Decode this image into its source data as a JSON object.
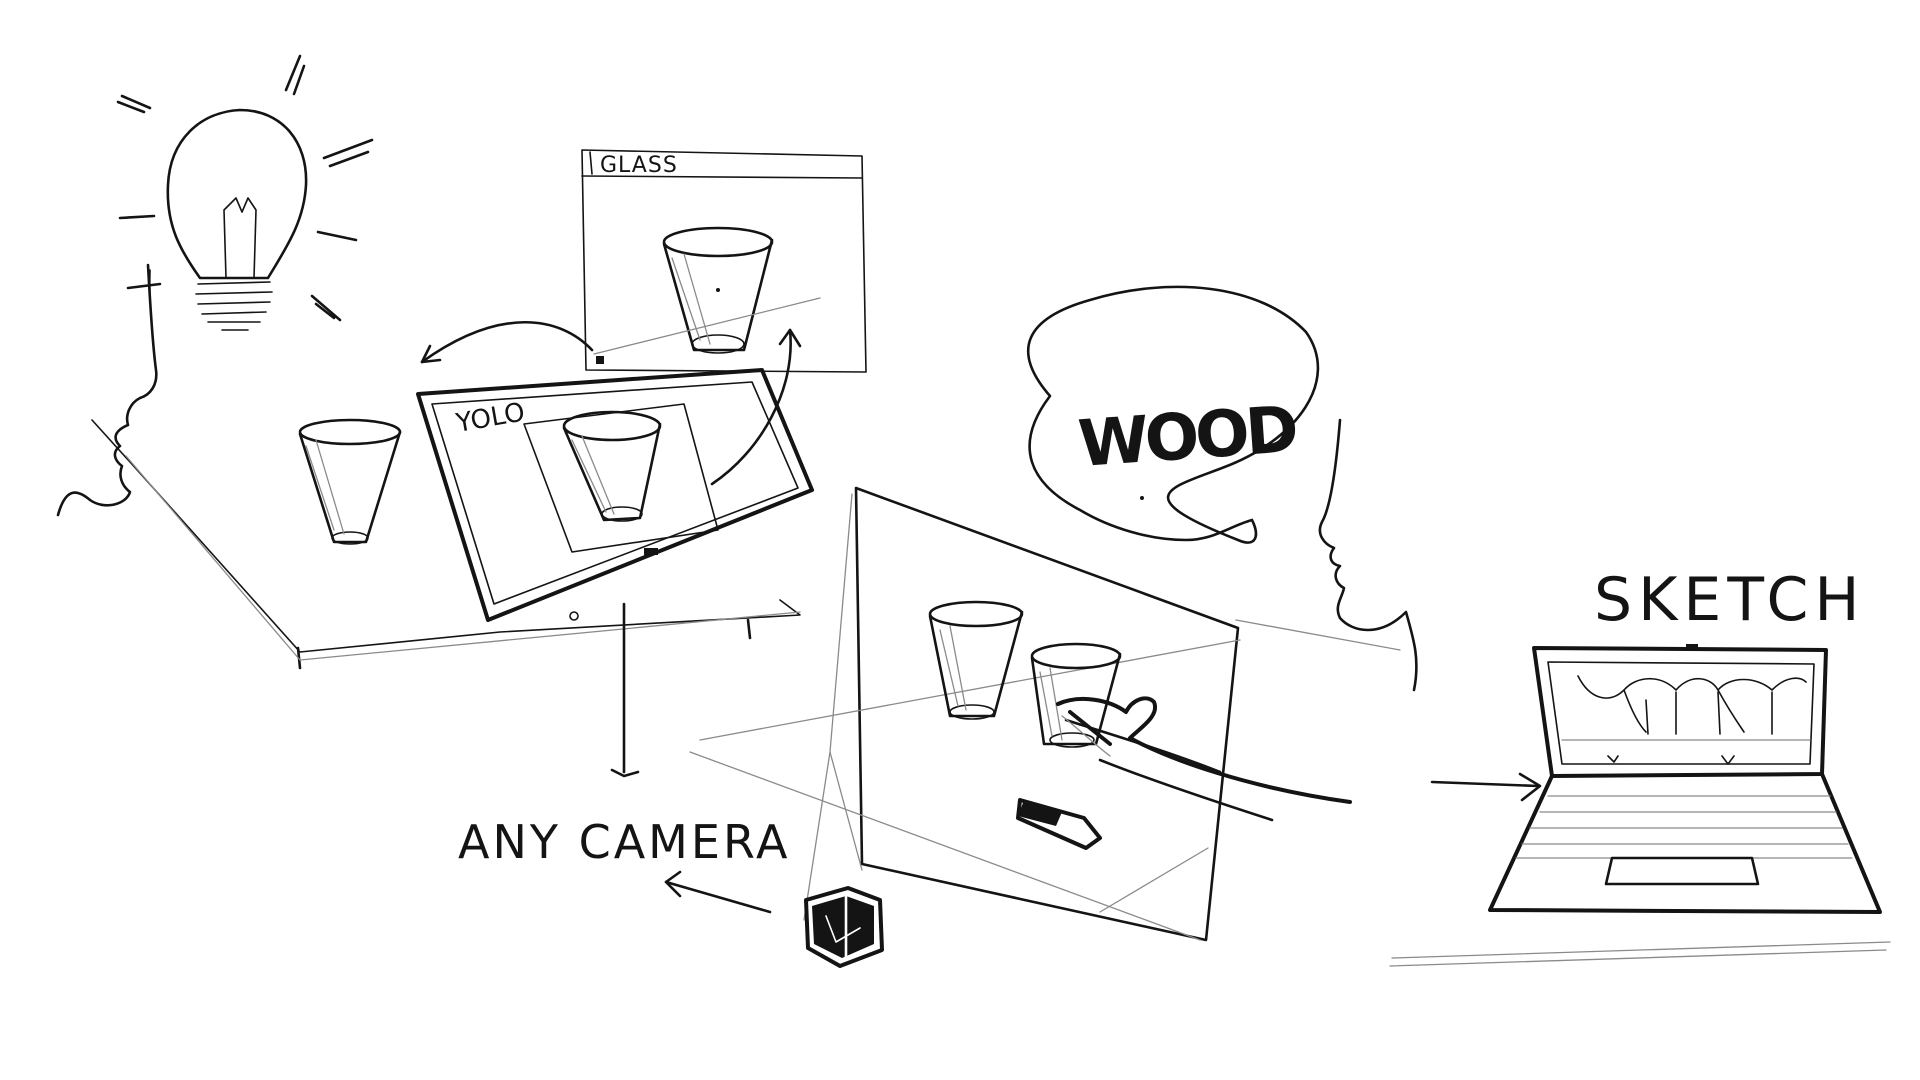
{
  "labels": {
    "glass_window_title": "GLASS",
    "tablet_app_name": "YOLO",
    "speech_bubble_word": "WOOD",
    "camera_caption": "ANY CAMERA",
    "laptop_caption": "SKETCH"
  },
  "icons": {
    "idea": "light-bulb-icon",
    "camera": "camera-icon",
    "computer": "laptop-icon"
  },
  "colors": {
    "ink": "#141414",
    "paper": "#ffffff",
    "pencil": "#8a8a8a"
  }
}
